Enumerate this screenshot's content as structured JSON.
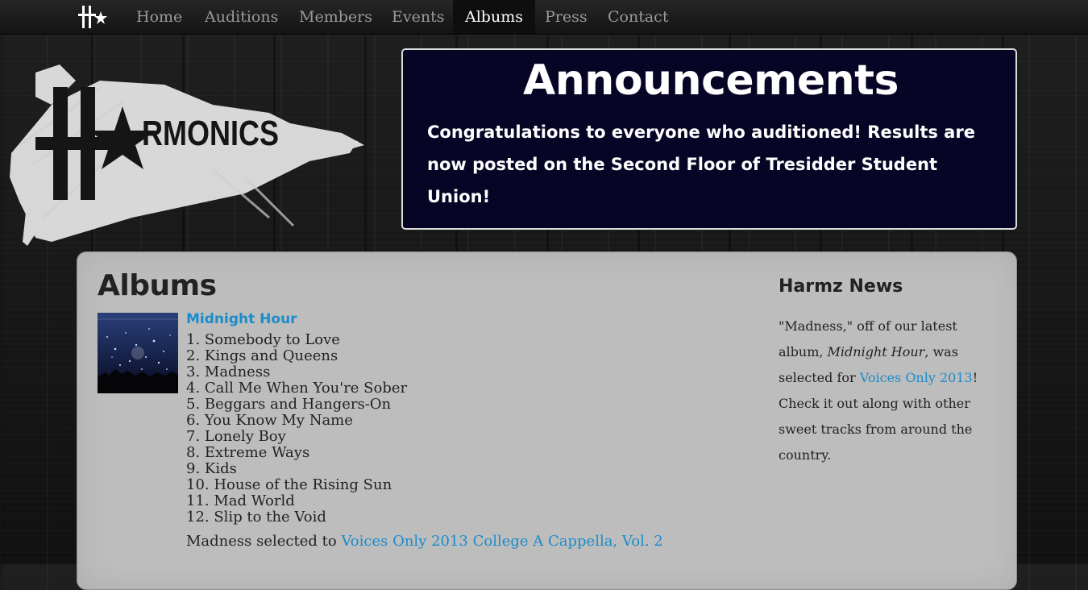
{
  "nav": {
    "items": [
      {
        "label": "Home"
      },
      {
        "label": "Auditions"
      },
      {
        "label": "Members"
      },
      {
        "label": "Events"
      },
      {
        "label": "Albums",
        "active": true
      },
      {
        "label": "Press"
      },
      {
        "label": "Contact"
      }
    ]
  },
  "logo": {
    "text": "RMONICS"
  },
  "announcements": {
    "title": "Announcements",
    "body": "Congratulations to everyone who auditioned! Results are now posted on the Second Floor of Tresidder Student Union!"
  },
  "main": {
    "title": "Albums",
    "album": {
      "title": "Midnight Hour",
      "tracks": [
        "1. Somebody to Love",
        "2. Kings and Queens",
        "3. Madness",
        "4. Call Me When You're Sober",
        "5. Beggars and Hangers-On",
        "6. You Know My Name",
        "7. Lonely Boy",
        "8. Extreme Ways",
        "9. Kids",
        "10. House of the Rising Sun",
        "11. Mad World",
        "12. Slip to the Void"
      ],
      "selected_prefix": "Madness selected to ",
      "selected_link": "Voices Only 2013 College A Cappella, Vol. 2"
    }
  },
  "news": {
    "title": "Harmz News",
    "p1": "\"Madness,\" off of our latest album, ",
    "album_em": "Midnight Hour",
    "p2": ", was selected for ",
    "link": "Voices Only 2013",
    "p3": "! Check it out along with other sweet tracks from around the country."
  },
  "colors": {
    "link": "#1a8ccc",
    "announce_bg": "#060525",
    "panel_bg": "#bdbdbd"
  }
}
